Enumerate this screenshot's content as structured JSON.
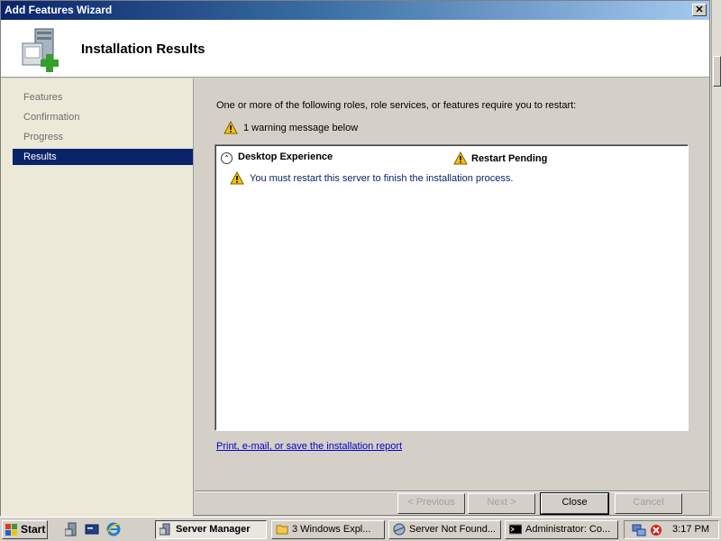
{
  "window": {
    "title": "Add Features Wizard",
    "close_label": "✕",
    "header_title": "Installation Results"
  },
  "sidebar": {
    "items": [
      {
        "label": "Features",
        "active": false
      },
      {
        "label": "Confirmation",
        "active": false
      },
      {
        "label": "Progress",
        "active": false
      },
      {
        "label": "Results",
        "active": true
      }
    ]
  },
  "main": {
    "intro": "One or more of the following roles, role services, or features require you to restart:",
    "warning_count": "1 warning message below",
    "results": {
      "name": "Desktop Experience",
      "status": "Restart Pending",
      "message": "You must restart this server to finish the installation process."
    },
    "report_link": "Print, e-mail, or save the installation report"
  },
  "buttons": {
    "previous": "< Previous",
    "next": "Next >",
    "close": "Close",
    "cancel": "Cancel"
  },
  "taskbar": {
    "start": "Start",
    "tasks": [
      {
        "label": "Server Manager",
        "icon": "server-manager-icon",
        "active": true
      },
      {
        "label": "3 Windows Expl...",
        "icon": "folder-icon",
        "active": false
      },
      {
        "label": "Server Not Found...",
        "icon": "browser-icon",
        "active": false
      },
      {
        "label": "Administrator: Co...",
        "icon": "cmd-icon",
        "active": false
      }
    ],
    "clock": "3:17 PM"
  },
  "colors": {
    "selection": "#0a246a",
    "warning": "#f5c400",
    "link": "#0000cc"
  }
}
